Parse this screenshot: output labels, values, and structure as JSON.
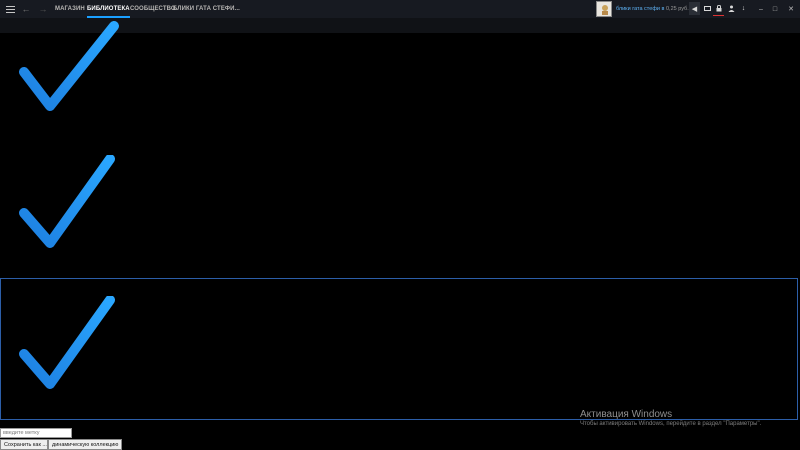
{
  "topbar": {
    "menu_icon": "hamburger-menu-icon",
    "back_icon": "arrow-left-icon",
    "forward_icon": "arrow-right-icon",
    "nav": [
      {
        "label": "МАГАЗИН",
        "active": false
      },
      {
        "label": "БИБЛИОТЕКА",
        "active": true
      },
      {
        "label": "СООБЩЕСТВО",
        "active": false
      },
      {
        "label": "БЛИКИ ГАТА СТЕФИ...",
        "active": false
      }
    ],
    "username": "блики гата стефи в",
    "balance": "0,25 руб.",
    "accent_color": "#1a9fff"
  },
  "content": {
    "checkmark_color": "#1e90ff",
    "checkmark_count": 3
  },
  "watermark": {
    "title": "Активация Windows",
    "subtitle": "Чтобы активировать Windows, перейдите в раздел \"Параметры\"."
  },
  "controls": {
    "tag_placeholder": "введите метку",
    "save_label": "Сохранить как ...",
    "dynamic_label": "динамическую коллекцию"
  }
}
